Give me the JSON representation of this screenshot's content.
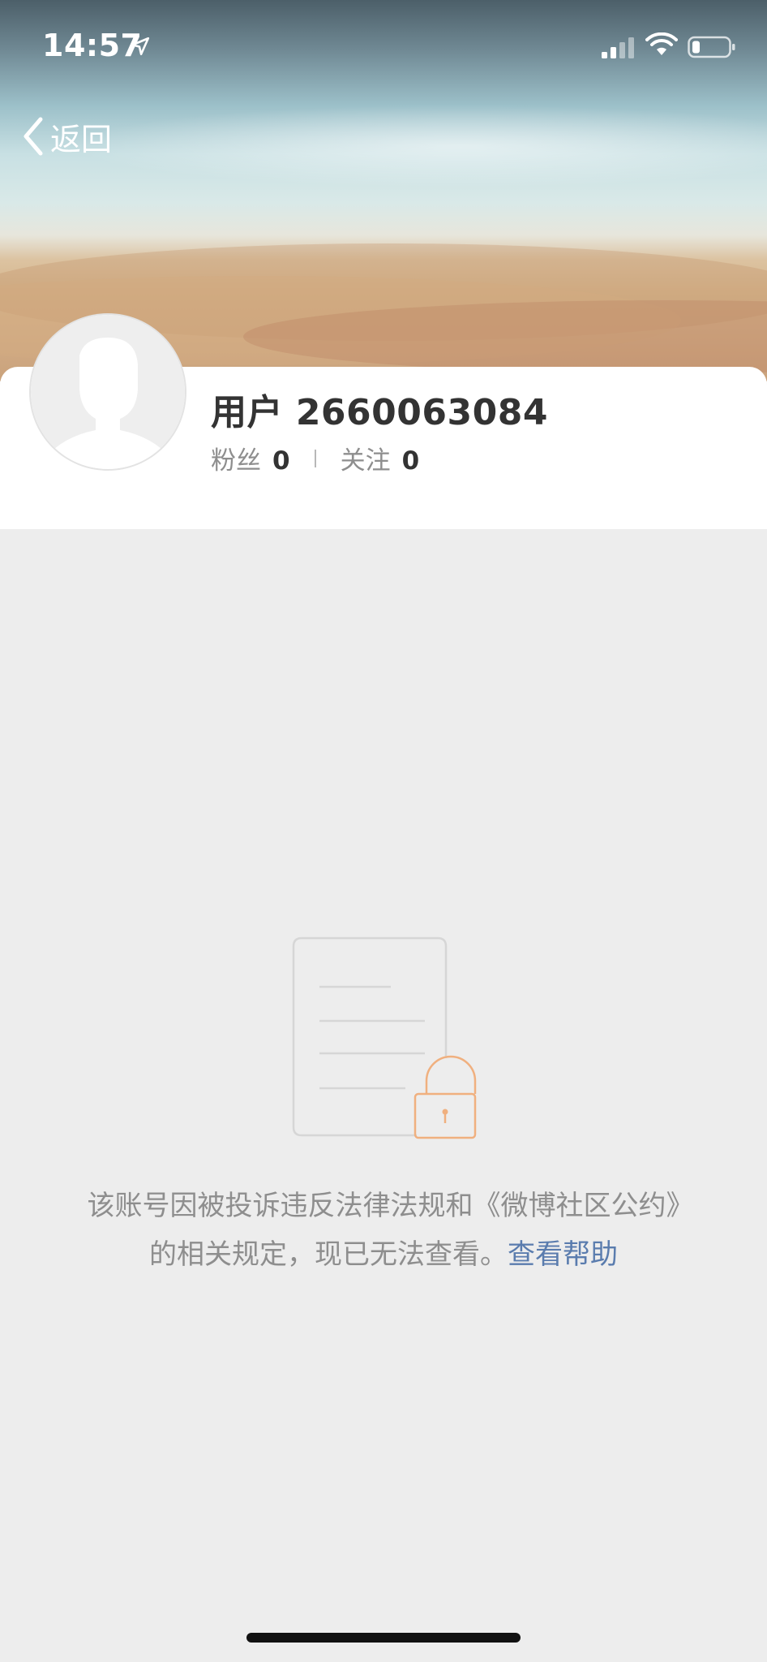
{
  "status_bar": {
    "time": "14:57",
    "location_icon": "location-arrow-icon",
    "signal_icon": "cellular-signal-icon",
    "wifi_icon": "wifi-icon",
    "battery_icon": "battery-low-icon"
  },
  "nav": {
    "back_label": "返回",
    "back_icon": "chevron-left-icon"
  },
  "profile": {
    "username": "用户 2660063084",
    "followers_label": "粉丝",
    "followers_count": "0",
    "following_label": "关注",
    "following_count": "0",
    "avatar_icon": "default-avatar-icon"
  },
  "notice": {
    "icon": "locked-document-icon",
    "message": "该账号因被投诉违反法律法规和《微博社区公约》的相关规定，现已无法查看。",
    "help_link": "查看帮助"
  },
  "colors": {
    "page_bg": "#ededed",
    "card_bg": "#ffffff",
    "link": "#5a7cae",
    "lock_accent": "#f0b07f",
    "muted_text": "#8e8e8e",
    "primary_text": "#333333"
  }
}
